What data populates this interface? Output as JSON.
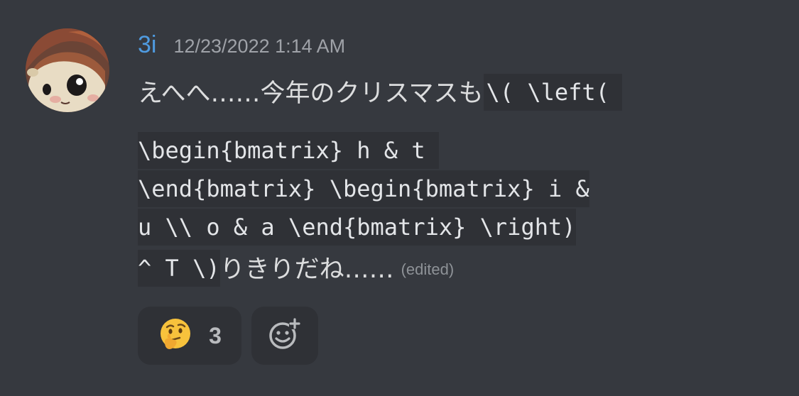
{
  "message": {
    "author": "3i",
    "timestamp": "12/23/2022 1:14 AM",
    "line1_text": "えへへ……今年のクリスマスも",
    "line1_code": "\\( \\left(",
    "line2_code": "\\begin{bmatrix} h & t ",
    "line3_code": "\\end{bmatrix} \\begin{bmatrix} i &",
    "line4_code": "u \\\\ o & a \\end{bmatrix} \\right)",
    "line5_code": "^ T \\)",
    "line5_text": "りきりだね……",
    "edited_label": "(edited)"
  },
  "reactions": [
    {
      "emoji": "thinking-face",
      "count": "3"
    }
  ],
  "colors": {
    "background": "#36393f",
    "username": "#4f9be0",
    "code_background": "#2f3136",
    "text": "#dcddde"
  }
}
